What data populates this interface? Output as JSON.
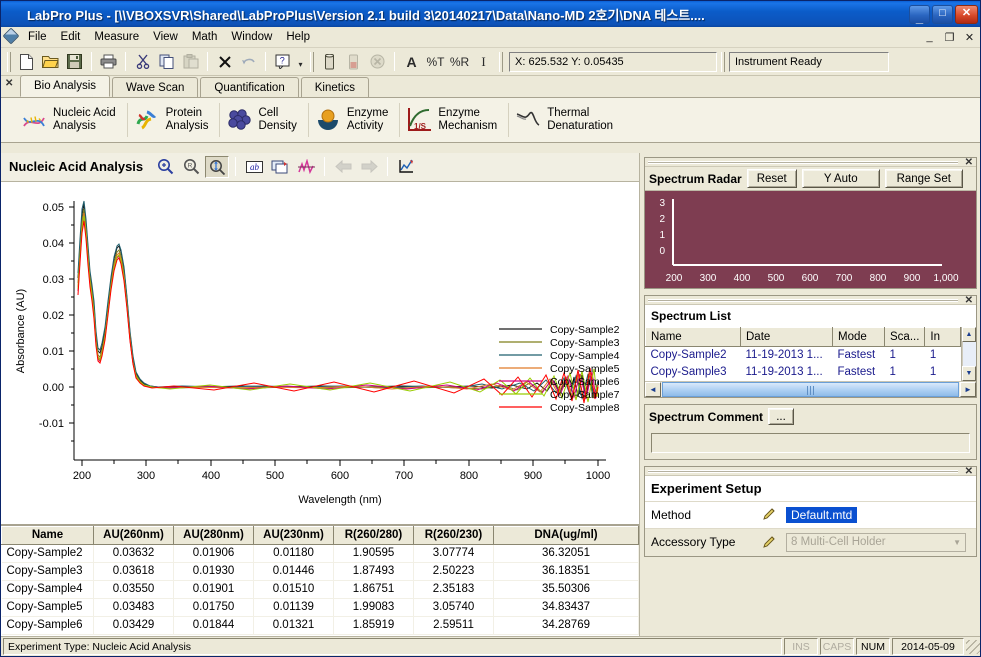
{
  "window": {
    "title": "LabPro Plus - [\\\\VBOXSVR\\Shared\\LabProPlus\\Version 2.1 build 3\\20140217\\Data\\Nano-MD 2호기\\DNA 테스트....",
    "minimize_label": "_",
    "maximize_label": "□",
    "close_label": "✕",
    "app_icon": "dna-app-icon"
  },
  "menu": {
    "items": [
      {
        "label": "File"
      },
      {
        "label": "Edit"
      },
      {
        "label": "Measure"
      },
      {
        "label": "View"
      },
      {
        "label": "Math"
      },
      {
        "label": "Window"
      },
      {
        "label": "Help"
      }
    ],
    "mdi": {
      "minimize": "_",
      "restore": "❐",
      "close": "✕"
    }
  },
  "toolbar": {
    "buttons": [
      {
        "name": "new-icon",
        "title": "New"
      },
      {
        "name": "open-icon",
        "title": "Open"
      },
      {
        "name": "save-icon",
        "title": "Save"
      },
      {
        "name": "print-icon",
        "title": "Print"
      },
      {
        "name": "cut-icon",
        "title": "Cut"
      },
      {
        "name": "copy-icon",
        "title": "Copy"
      },
      {
        "name": "paste-icon",
        "title": "Paste"
      },
      {
        "name": "delete-x-icon",
        "title": "Delete"
      },
      {
        "name": "undo-icon",
        "title": "Undo"
      },
      {
        "name": "help-icon",
        "title": "Help"
      },
      {
        "name": "cuvette-icon",
        "title": "Blank"
      },
      {
        "name": "cuvette-sample-icon",
        "title": "Sample"
      },
      {
        "name": "stop-icon",
        "title": "Stop"
      },
      {
        "name": "abs-mode-icon",
        "label": "A"
      },
      {
        "name": "percent-t-icon",
        "label": "%T"
      },
      {
        "name": "percent-r-icon",
        "label": "%R"
      },
      {
        "name": "energy-icon",
        "label": "I"
      }
    ],
    "coordinate_readout": "X: 625.532 Y: 0.05435",
    "instrument_status": "Instrument Ready"
  },
  "tabs": {
    "close_label": "✕",
    "items": [
      {
        "label": "Bio Analysis",
        "active": true
      },
      {
        "label": "Wave Scan",
        "active": false
      },
      {
        "label": "Quantification",
        "active": false
      },
      {
        "label": "Kinetics",
        "active": false
      }
    ]
  },
  "ribbon": {
    "buttons": [
      {
        "icon": "dna-helix-icon",
        "line1": "Nucleic Acid",
        "line2": "Analysis"
      },
      {
        "icon": "protein-ribbon-icon",
        "line1": "Protein",
        "line2": "Analysis"
      },
      {
        "icon": "cell-cluster-icon",
        "line1": "Cell",
        "line2": "Density"
      },
      {
        "icon": "enzyme-flask-icon",
        "line1": "Enzyme",
        "line2": "Activity"
      },
      {
        "icon": "kinetics-curve-icon",
        "line1": "Enzyme",
        "line2": "Mechanism"
      },
      {
        "icon": "thermal-curve-icon",
        "line1": "Thermal",
        "line2": "Denaturation"
      }
    ]
  },
  "chart_panel": {
    "title": "Nucleic Acid Analysis",
    "tools": [
      {
        "name": "zoom-in-icon"
      },
      {
        "name": "zoom-out-icon"
      },
      {
        "name": "zoom-fit-icon",
        "pressed": true
      },
      {
        "name": "label-ab-icon"
      },
      {
        "name": "copy-graph-icon"
      },
      {
        "name": "peak-pick-icon"
      },
      {
        "name": "nav-back-icon",
        "disabled": true
      },
      {
        "name": "nav-forward-icon",
        "disabled": true
      },
      {
        "name": "graph-properties-icon"
      }
    ]
  },
  "chart_data": {
    "type": "line",
    "title": "",
    "xlabel": "Wavelength (nm)",
    "ylabel": "Absorbance (AU)",
    "xlim": [
      190,
      1010
    ],
    "ylim": [
      -0.012,
      0.054
    ],
    "xticks": [
      200,
      300,
      400,
      500,
      600,
      700,
      800,
      900,
      1000
    ],
    "yticks": [
      -0.01,
      0.0,
      0.01,
      0.02,
      0.03,
      0.04,
      0.05
    ],
    "grid": false,
    "legend_position": "right",
    "series": [
      {
        "name": "Copy-Sample2",
        "color": "#000000",
        "peak260": 0.03632
      },
      {
        "name": "Copy-Sample3",
        "color": "#808000",
        "peak260": 0.03618
      },
      {
        "name": "Copy-Sample4",
        "color": "#1f5f6e",
        "peak260": 0.0355
      },
      {
        "name": "Copy-Sample5",
        "color": "#e07a28",
        "peak260": 0.03483
      },
      {
        "name": "Copy-Sample6",
        "color": "#d4007f",
        "peak260": 0.03429
      },
      {
        "name": "Copy-Sample7",
        "color": "#99cc00",
        "peak260": 0.034
      },
      {
        "name": "Copy-Sample8",
        "color": "#ff0000",
        "peak260": 0.0338
      }
    ]
  },
  "data_table": {
    "columns": [
      "Name",
      "AU(260nm)",
      "AU(280nm)",
      "AU(230nm)",
      "R(260/280)",
      "R(260/230)",
      "DNA(ug/ml)"
    ],
    "rows": [
      [
        "Copy-Sample2",
        "0.03632",
        "0.01906",
        "0.01180",
        "1.90595",
        "3.07774",
        "36.32051"
      ],
      [
        "Copy-Sample3",
        "0.03618",
        "0.01930",
        "0.01446",
        "1.87493",
        "2.50223",
        "36.18351"
      ],
      [
        "Copy-Sample4",
        "0.03550",
        "0.01901",
        "0.01510",
        "1.86751",
        "2.35183",
        "35.50306"
      ],
      [
        "Copy-Sample5",
        "0.03483",
        "0.01750",
        "0.01139",
        "1.99083",
        "3.05740",
        "34.83437"
      ],
      [
        "Copy-Sample6",
        "0.03429",
        "0.01844",
        "0.01321",
        "1.85919",
        "2.59511",
        "34.28769"
      ]
    ]
  },
  "spectrum_radar": {
    "title": "Spectrum Radar",
    "close_label": "✕",
    "buttons": [
      {
        "label": "Reset",
        "name": "reset-button"
      },
      {
        "label": "Y Auto",
        "name": "y-auto-button"
      },
      {
        "label": "Range Set",
        "name": "range-set-button"
      }
    ],
    "plot": {
      "background_color": "#7e3d51",
      "yticks": [
        "3",
        "2",
        "1",
        "0"
      ],
      "xticks": [
        "200",
        "300",
        "400",
        "500",
        "600",
        "700",
        "800",
        "900",
        "1,000"
      ]
    }
  },
  "spectrum_list": {
    "title": "Spectrum List",
    "close_label": "✕",
    "columns": [
      "Name",
      "Date",
      "Mode",
      "Sca...",
      "In"
    ],
    "rows": [
      [
        "Copy-Sample2",
        "11-19-2013 1...",
        "Fastest",
        "1",
        "1"
      ],
      [
        "Copy-Sample3",
        "11-19-2013 1...",
        "Fastest",
        "1",
        "1"
      ]
    ],
    "scroll_up": "▲",
    "scroll_down": "▼",
    "scroll_left": "◄",
    "scroll_right": "►"
  },
  "spectrum_comment": {
    "title": "Spectrum Comment",
    "browse_label": "...",
    "value": "",
    "placeholder": ""
  },
  "experiment_setup": {
    "title": "Experiment Setup",
    "close_label": "✕",
    "method_label": "Method",
    "method_value": "Default.mtd",
    "accessory_label": "Accessory Type",
    "accessory_value": "8 Multi-Cell Holder",
    "dropdown_arrow": "▼",
    "edit_icon": "pencil-icon"
  },
  "statusbar": {
    "message": "Experiment Type: Nucleic Acid Analysis",
    "ins": "INS",
    "caps": "CAPS",
    "num": "NUM",
    "date": "2014-05-09"
  }
}
